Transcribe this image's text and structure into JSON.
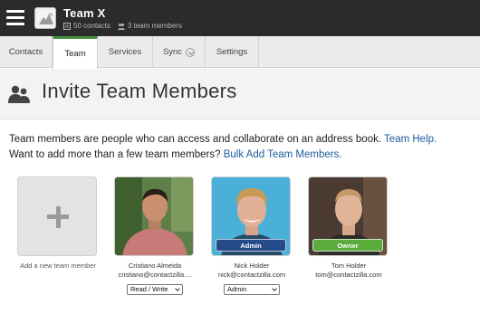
{
  "header": {
    "team_name": "Team X",
    "contacts_count": "50 contacts",
    "members_count": "3 team members"
  },
  "tabs": [
    {
      "label": "Contacts",
      "active": false
    },
    {
      "label": "Team",
      "active": true
    },
    {
      "label": "Services",
      "active": false
    },
    {
      "label": "Sync",
      "active": false
    },
    {
      "label": "Settings",
      "active": false
    }
  ],
  "page": {
    "title": "Invite Team Members",
    "desc_line1": "Team members are people who can access and collaborate on an address book. ",
    "team_help_link": "Team Help.",
    "desc_line2": "Want to add more than a few team members? ",
    "bulk_add_link": "Bulk Add Team Members."
  },
  "add_card": {
    "label": "Add a new team member"
  },
  "members": [
    {
      "name": "Cristiano Almeida",
      "email": "cristiano@contactzilla....",
      "role_select": "Read / Write",
      "badge": ""
    },
    {
      "name": "Nick Holder",
      "email": "nick@contactzilla.com",
      "role_select": "Admin",
      "badge": "Admin"
    },
    {
      "name": "Tom Holder",
      "email": "tom@contactzilla.com",
      "role_select": "",
      "badge": "Owner"
    }
  ],
  "colors": {
    "topbar": "#2b2b2b",
    "active_tab_accent": "#3f8f3f",
    "link": "#1c5b9b",
    "admin_badge": "#244a8a",
    "owner_badge": "#5aac3c"
  },
  "icons": {
    "menu": "hamburger-icon",
    "contacts": "address-book-icon",
    "members": "people-icon",
    "heading": "team-icon",
    "add": "plus-icon"
  }
}
